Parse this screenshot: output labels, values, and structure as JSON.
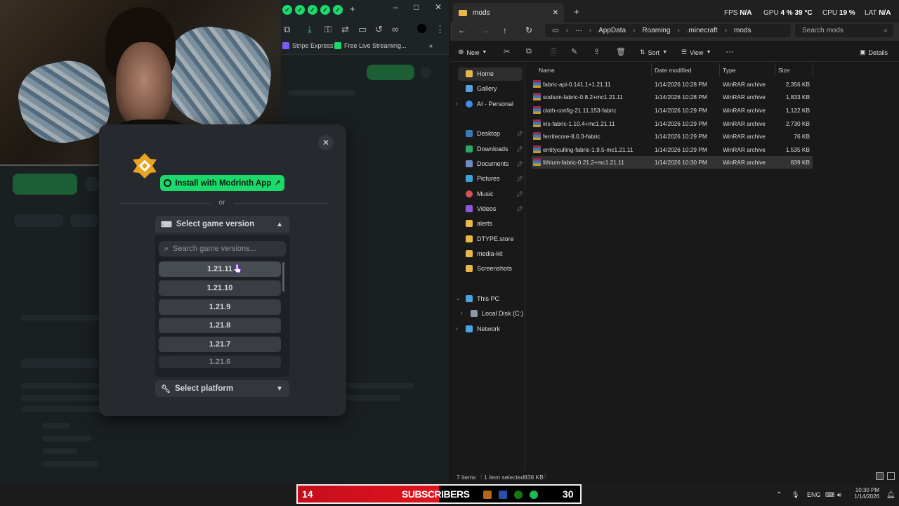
{
  "overlay": {
    "fps_label": "FPS",
    "fps_value": "N/A",
    "gpu_label": "GPU",
    "gpu_pct": "4 %",
    "gpu_temp": "39 °C",
    "cpu_label": "CPU",
    "cpu_pct": "19 %",
    "lat_label": "LAT",
    "lat_value": "N/A"
  },
  "browser": {
    "bookmarks": [
      "Stripe Express",
      "Free Live Streaming..."
    ]
  },
  "modal": {
    "install_label": "Install with Modrinth App",
    "or_label": "or",
    "game_version_label": "Select game version",
    "search_placeholder": "Search game versions...",
    "versions": [
      "1.21.11",
      "1.21.10",
      "1.21.9",
      "1.21.8",
      "1.21.7",
      "1.21.6"
    ],
    "platform_label": "Select platform",
    "accent": "#1bd96a"
  },
  "explorer": {
    "tab_title": "mods",
    "breadcrumb": [
      "AppData",
      "Roaming",
      ".minecraft",
      "mods"
    ],
    "search_placeholder": "Search mods",
    "commands": {
      "new": "New",
      "sort": "Sort",
      "view": "View",
      "details": "Details"
    },
    "nav": {
      "home": "Home",
      "gallery": "Gallery",
      "ai_personal": "AI - Personal",
      "quick": [
        "Desktop",
        "Downloads",
        "Documents",
        "Pictures",
        "Music",
        "Videos",
        "alerts",
        "DTYPE.store",
        "media-kit",
        "Screenshots"
      ],
      "this_pc": "This PC",
      "local_disk": "Local Disk (C:)",
      "network": "Network"
    },
    "columns": [
      "Name",
      "Date modified",
      "Type",
      "Size"
    ],
    "files": [
      {
        "name": "fabric-api-0.141.1+1.21.11",
        "date": "1/14/2026 10:28 PM",
        "type": "WinRAR archive",
        "size": "2,356 KB"
      },
      {
        "name": "sodium-fabric-0.8.2+mc1.21.11",
        "date": "1/14/2026 10:28 PM",
        "type": "WinRAR archive",
        "size": "1,833 KB"
      },
      {
        "name": "cloth-config-21.11.153-fabric",
        "date": "1/14/2026 10:29 PM",
        "type": "WinRAR archive",
        "size": "1,122 KB"
      },
      {
        "name": "iris-fabric-1.10.4+mc1.21.11",
        "date": "1/14/2026 10:29 PM",
        "type": "WinRAR archive",
        "size": "2,730 KB"
      },
      {
        "name": "ferritecore-8.0.3-fabric",
        "date": "1/14/2026 10:29 PM",
        "type": "WinRAR archive",
        "size": "76 KB"
      },
      {
        "name": "entityculling-fabric-1.9.5-mc1.21.11",
        "date": "1/14/2026 10:29 PM",
        "type": "WinRAR archive",
        "size": "1,535 KB"
      },
      {
        "name": "lithium-fabric-0.21.2+mc1.21.11",
        "date": "1/14/2026 10:30 PM",
        "type": "WinRAR archive",
        "size": "839 KB"
      }
    ],
    "status": {
      "items": "7 items",
      "selected": "1 item selected",
      "sel_size": "838 KB"
    }
  },
  "taskbar": {
    "sub_count_left": "14",
    "sub_label": "SUBSCRIBERS",
    "sub_count_right": "30",
    "lang": "ENG",
    "time": "10:30 PM",
    "date": "1/14/2026"
  }
}
